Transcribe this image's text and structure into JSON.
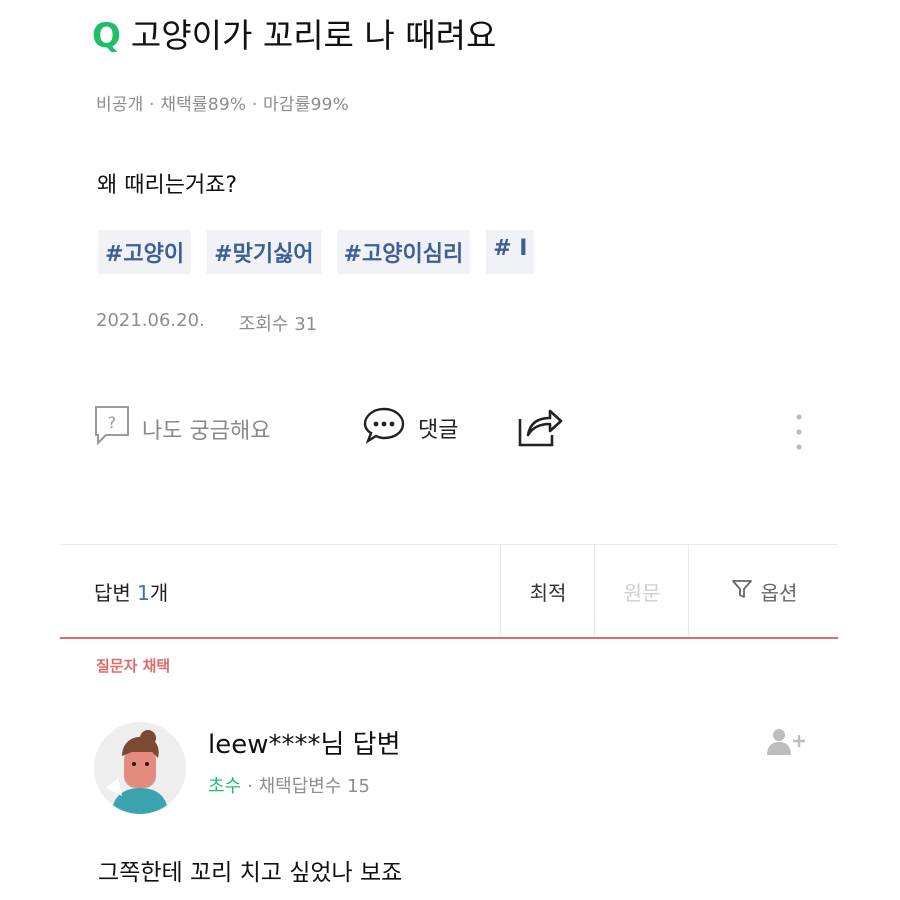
{
  "question": {
    "mark": "Q",
    "title": "고양이가 꼬리로 나 때려요",
    "meta": "비공개 · 채택률89% · 마감률99%",
    "body": "왜 때리는거죠?",
    "tags": [
      "#고양이",
      "#맞기싫어",
      "#고양이심리",
      "# I"
    ],
    "date": "2021.06.20.",
    "views": "조회수 31"
  },
  "actions": {
    "curious_label": "나도 궁금해요",
    "comment_label": "댓글"
  },
  "answers_bar": {
    "prefix": "답변 ",
    "count": "1",
    "suffix": "개",
    "sort_best": "최적",
    "sort_original": "원문",
    "options": "옵션"
  },
  "answer": {
    "chosen_label": "질문자 채택",
    "user": "leew****님 답변",
    "rank": "초수",
    "adopted": "· 채택답변수 15",
    "text": "그쪽한테 꼬리 치고 싶었나 보죠"
  },
  "colors": {
    "accent_green": "#1fbf6a",
    "tag_text": "#3d5f98",
    "count_blue": "#3f6cc9",
    "chosen_red": "#e36a6a"
  }
}
